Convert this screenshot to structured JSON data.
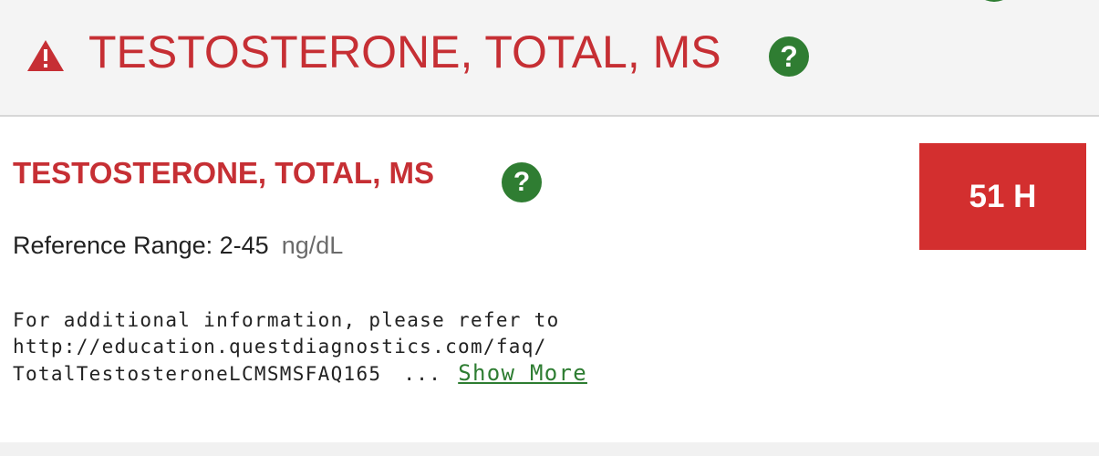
{
  "header": {
    "title": "TESTOSTERONE, TOTAL, MS",
    "help_icon": "?"
  },
  "result": {
    "name": "TESTOSTERONE, TOTAL, MS",
    "help_icon": "?",
    "value": "51 H",
    "reference_range": "Reference Range: 2-45",
    "unit": "ng/dL",
    "info_lines": [
      "For additional information, please refer to",
      "http://education.questdiagnostics.com/faq/",
      "TotalTestosteroneLCMSMSFAQ165"
    ],
    "ellipsis": "...",
    "show_more_label": "Show More"
  },
  "colors": {
    "abnormal_red": "#c62f34",
    "result_box": "#d32f2f",
    "help_green": "#2f7d32",
    "link_green": "#2e7d32"
  },
  "icons": [
    "warning-triangle-icon",
    "help-icon"
  ]
}
